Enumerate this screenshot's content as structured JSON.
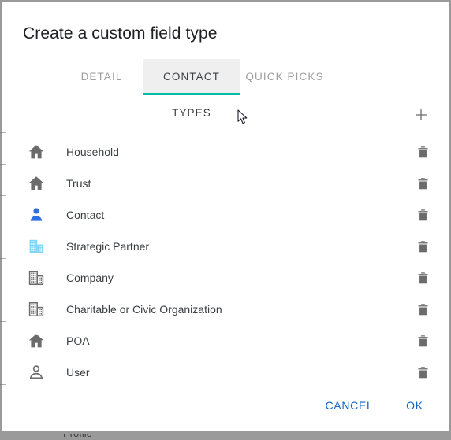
{
  "window": {
    "background_text": "Profile"
  },
  "dialog": {
    "title": "Create a custom field type",
    "tabs": [
      {
        "label": "DETAIL",
        "active": false
      },
      {
        "label": "CONTACT TYPES",
        "active": true
      },
      {
        "label": "QUICK PICKS",
        "active": false
      }
    ],
    "add_button": {
      "icon": "plus-icon",
      "label": "+"
    },
    "contact_types": [
      {
        "label": "Household",
        "icon": "home-icon",
        "icon_color": "#6b6b6b",
        "icon_style": "filled",
        "delete_icon": "trash-icon"
      },
      {
        "label": "Trust",
        "icon": "home-icon",
        "icon_color": "#6b6b6b",
        "icon_style": "filled",
        "delete_icon": "trash-icon"
      },
      {
        "label": "Contact",
        "icon": "person-icon",
        "icon_color": "#2f6fe0",
        "icon_style": "filled",
        "delete_icon": "trash-icon"
      },
      {
        "label": "Strategic Partner",
        "icon": "building-icon",
        "icon_color": "#7fd4f7",
        "icon_style": "filled",
        "delete_icon": "trash-icon"
      },
      {
        "label": "Company",
        "icon": "building-icon",
        "icon_color": "#6b6b6b",
        "icon_style": "outline",
        "delete_icon": "trash-icon"
      },
      {
        "label": "Charitable or Civic Organization",
        "icon": "building-icon",
        "icon_color": "#6b6b6b",
        "icon_style": "outline",
        "delete_icon": "trash-icon"
      },
      {
        "label": "POA",
        "icon": "home-icon",
        "icon_color": "#6b6b6b",
        "icon_style": "filled",
        "delete_icon": "trash-icon"
      },
      {
        "label": "User",
        "icon": "person-icon",
        "icon_color": "#6b6b6b",
        "icon_style": "outline",
        "delete_icon": "trash-icon"
      }
    ],
    "footer": {
      "cancel_label": "CANCEL",
      "ok_label": "OK"
    }
  },
  "colors": {
    "accent_teal": "#00bfa5",
    "link_blue": "#1565c0",
    "active_tab_bg": "#efefef",
    "frame_gray": "#9a9a9a",
    "text_primary": "#3c4043",
    "text_muted": "#9e9e9e"
  }
}
